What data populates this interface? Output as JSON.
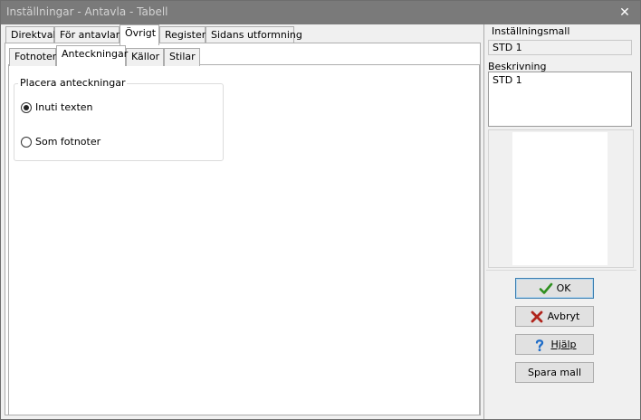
{
  "window": {
    "title": "Inställningar - Antavla - Tabell",
    "close_glyph": "✕"
  },
  "main_tabs": [
    {
      "label": "Direktval"
    },
    {
      "label": "För antavlan"
    },
    {
      "label": "Övrigt",
      "active": true
    },
    {
      "label": "Register"
    },
    {
      "label": "Sidans utformning"
    }
  ],
  "sub_tabs": [
    {
      "label": "Fotnoter"
    },
    {
      "label": "Anteckningar",
      "active": true
    },
    {
      "label": "Källor"
    },
    {
      "label": "Stilar"
    }
  ],
  "group": {
    "label": "Placera anteckningar",
    "options": [
      {
        "label": "Inuti texten",
        "selected": true
      },
      {
        "label": "Som fotnoter",
        "selected": false
      }
    ]
  },
  "right": {
    "template_label": "Inställningsmall",
    "template_value": "STD 1",
    "description_label": "Beskrivning",
    "description_value": "STD 1"
  },
  "buttons": {
    "ok": "OK",
    "cancel": "Avbryt",
    "help": "Hjälp",
    "save_template": "Spara mall"
  },
  "icons": {
    "ok": "check-icon",
    "cancel": "x-icon",
    "help": "question-icon"
  },
  "colors": {
    "ok_icon": "#2f8f1f",
    "cancel_icon": "#b0241c",
    "help_icon": "#1e6cc8",
    "titlebar": "#7a7a7a"
  }
}
